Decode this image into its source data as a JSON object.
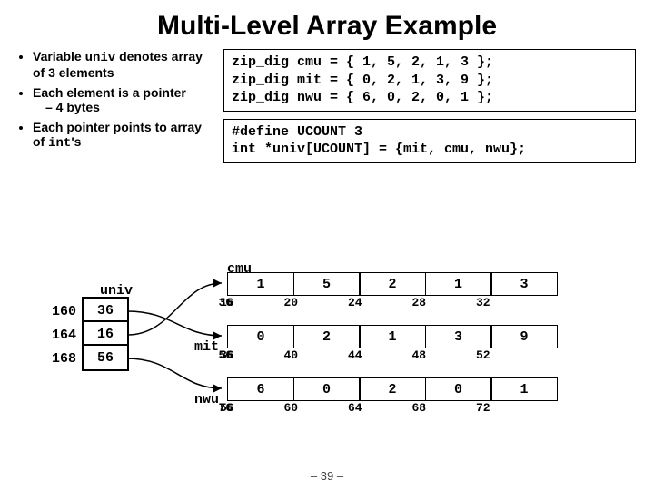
{
  "title": "Multi-Level Array Example",
  "bullets": {
    "b1_pre": "Variable ",
    "b1_code": "univ",
    "b1_post": " denotes array of 3 elements",
    "b2": "Each element is a pointer",
    "b2_sub": "– 4 bytes",
    "b3_pre": "Each pointer points to array of ",
    "b3_code": "int",
    "b3_post": "'s"
  },
  "code1": "zip_dig cmu = { 1, 5, 2, 1, 3 };\nzip_dig mit = { 0, 2, 1, 3, 9 };\nzip_dig nwu = { 6, 0, 2, 0, 1 };",
  "code2": "#define UCOUNT 3\nint *univ[UCOUNT] = {mit, cmu, nwu};",
  "univ_label": "univ",
  "univ": {
    "rows": [
      {
        "addr": "160",
        "val": "36"
      },
      {
        "addr": "164",
        "val": "16"
      },
      {
        "addr": "168",
        "val": "56"
      }
    ]
  },
  "arrays": {
    "cmu": {
      "label": "cmu",
      "cells": [
        "1",
        "5",
        "2",
        "1",
        "3"
      ],
      "addrs": [
        "16",
        "20",
        "24",
        "28",
        "32",
        "36"
      ]
    },
    "mit": {
      "label": "mit",
      "cells": [
        "0",
        "2",
        "1",
        "3",
        "9"
      ],
      "addrs": [
        "36",
        "40",
        "44",
        "48",
        "52",
        "56"
      ]
    },
    "nwu": {
      "label": "nwu",
      "cells": [
        "6",
        "0",
        "2",
        "0",
        "1"
      ],
      "addrs": [
        "56",
        "60",
        "64",
        "68",
        "72",
        "76"
      ]
    }
  },
  "pagenum": "– 39 –"
}
